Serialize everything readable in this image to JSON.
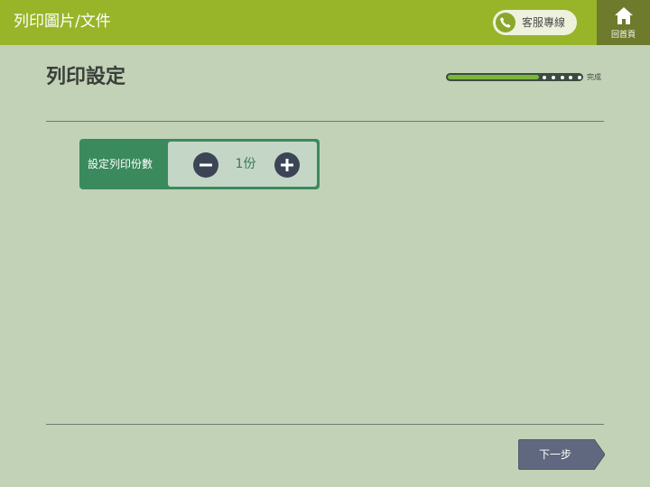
{
  "header": {
    "title": "列印圖片/文件",
    "support_label": "客服專線",
    "home_label": "回首頁"
  },
  "page": {
    "title": "列印設定",
    "progress": {
      "complete_label": "完成",
      "fraction": 0.68,
      "remaining_steps": 5
    }
  },
  "copies": {
    "label": "設定列印份數",
    "value": "1份"
  },
  "footer": {
    "next_label": "下一步"
  },
  "colors": {
    "header": "#98b52a",
    "background": "#c2d2b6",
    "panel": "#3b8a5e",
    "stepper_button": "#3c4555",
    "next_button": "#5f687e"
  },
  "icons": {
    "support": "phone-icon",
    "home": "home-icon",
    "decrease": "minus-icon",
    "increase": "plus-icon"
  }
}
